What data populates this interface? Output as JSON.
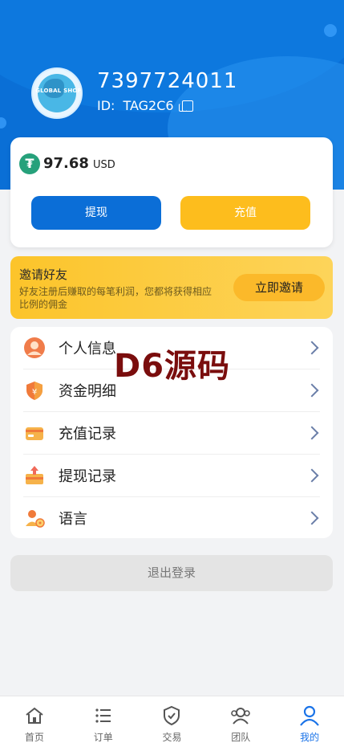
{
  "profile": {
    "username": "7397724011",
    "id_label": "ID:",
    "id_value": "TAG2C6",
    "avatar_text": "GLOBAL SHOP"
  },
  "balance": {
    "amount": "97.68",
    "currency": "USD",
    "icon": "tether-icon",
    "withdraw_label": "提现",
    "recharge_label": "充值"
  },
  "invite": {
    "title": "邀请好友",
    "desc": "好友注册后赚取的每笔利润，您都将获得相应比例的佣金",
    "button": "立即邀请"
  },
  "menu": {
    "items": [
      {
        "label": "个人信息",
        "icon": "user-avatar-icon"
      },
      {
        "label": "资金明细",
        "icon": "fund-shield-icon"
      },
      {
        "label": "充值记录",
        "icon": "card-icon"
      },
      {
        "label": "提现记录",
        "icon": "withdraw-box-icon"
      },
      {
        "label": "语言",
        "icon": "language-person-icon"
      }
    ]
  },
  "logout_label": "退出登录",
  "watermark": "D6源码",
  "tabbar": {
    "tabs": [
      {
        "label": "首页",
        "icon": "home-icon"
      },
      {
        "label": "订单",
        "icon": "list-icon"
      },
      {
        "label": "交易",
        "icon": "shield-check-icon"
      },
      {
        "label": "团队",
        "icon": "team-icon"
      },
      {
        "label": "我的",
        "icon": "profile-icon",
        "active": true
      }
    ]
  },
  "colors": {
    "primary": "#0b6ed7",
    "accent": "#fdbd1d",
    "active_tab": "#1a73e8"
  }
}
